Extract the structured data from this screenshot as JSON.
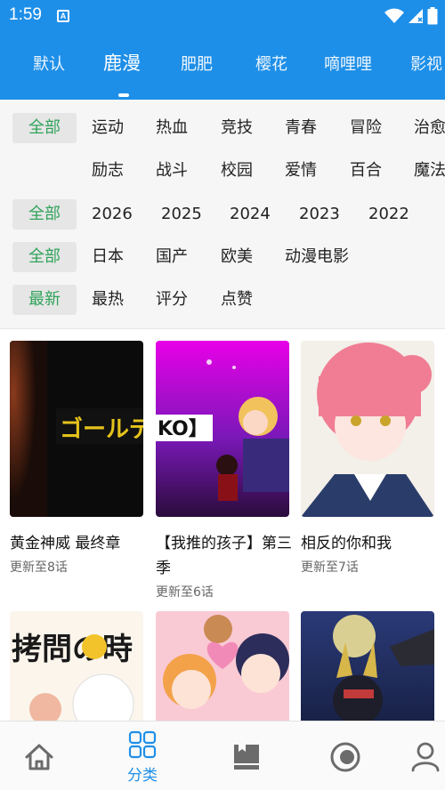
{
  "status_bar": {
    "time": "1:59",
    "app_badge": "A"
  },
  "source_tabs": [
    {
      "label": "默认",
      "active": false
    },
    {
      "label": "鹿漫",
      "active": true
    },
    {
      "label": "肥肥",
      "active": false
    },
    {
      "label": "樱花",
      "active": false
    },
    {
      "label": "嘀哩哩",
      "active": false
    },
    {
      "label": "影视",
      "active": false
    }
  ],
  "filters": {
    "genre": {
      "selected": "全部",
      "row1": [
        "运动",
        "热血",
        "竞技",
        "青春",
        "冒险",
        "治愈"
      ],
      "row2": [
        "励志",
        "战斗",
        "校园",
        "爱情",
        "百合",
        "魔法"
      ]
    },
    "year": {
      "selected": "全部",
      "options": [
        "2026",
        "2025",
        "2024",
        "2023",
        "2022"
      ]
    },
    "region": {
      "selected": "全部",
      "options": [
        "日本",
        "国产",
        "欧美",
        "动漫电影"
      ]
    },
    "sort": {
      "selected": "最新",
      "options": [
        "最热",
        "评分",
        "点赞"
      ]
    }
  },
  "cards": [
    {
      "title": "黄金神威 最终章",
      "subtitle": "更新至8话",
      "cover_text": "ゴールデン"
    },
    {
      "title": "【我推的孩子】第三季",
      "subtitle": "更新至6话",
      "cover_text": "KO】"
    },
    {
      "title": "相反的你和我",
      "subtitle": "更新至7话"
    },
    {
      "title": "",
      "subtitle": "",
      "cover_text": "拷問の時"
    },
    {
      "title": "",
      "subtitle": ""
    },
    {
      "title": "",
      "subtitle": ""
    }
  ],
  "bottom_nav": {
    "items": [
      {
        "icon": "home-icon",
        "label": ""
      },
      {
        "icon": "category-icon",
        "label": "分类",
        "active": true
      },
      {
        "icon": "library-icon",
        "label": ""
      },
      {
        "icon": "history-icon",
        "label": ""
      },
      {
        "icon": "profile-icon",
        "label": ""
      }
    ]
  },
  "colors": {
    "primary": "#1e8fe8",
    "selected_chip_text": "#2fa35a",
    "chip_bg": "#e6e6e6"
  }
}
